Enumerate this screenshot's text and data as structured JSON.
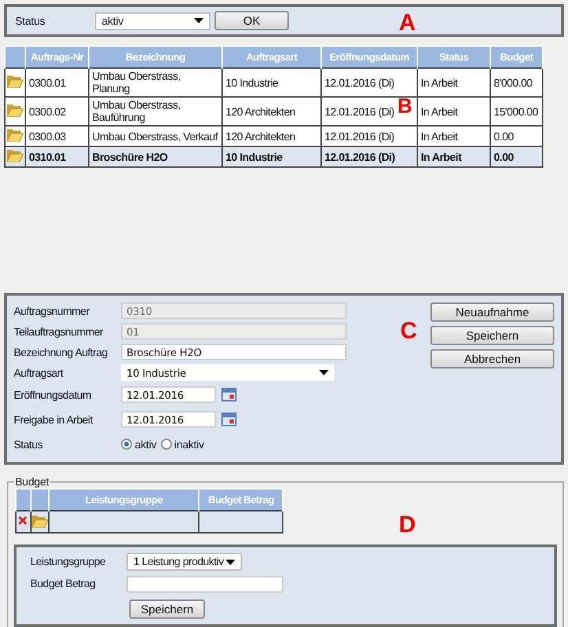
{
  "filter": {
    "label": "Status",
    "value": "aktiv",
    "button": "OK",
    "marker": "A"
  },
  "orders": {
    "marker": "B",
    "columns": [
      "Auftrags-Nr",
      "Bezeichnung",
      "Auftragsart",
      "Eröffnungsdatum",
      "Status",
      "Budget"
    ],
    "rows": [
      {
        "selected": false,
        "cells": [
          "0300.01",
          "Umbau Oberstrass, Planung",
          "10 Industrie",
          "12.01.2016 (Di)",
          "In Arbeit",
          "8'000.00"
        ]
      },
      {
        "selected": false,
        "cells": [
          "0300.02",
          "Umbau Oberstrass, Bauführung",
          "120 Architekten",
          "12.01.2016 (Di)",
          "In Arbeit",
          "15'000.00"
        ]
      },
      {
        "selected": false,
        "cells": [
          "0300.03",
          "Umbau Oberstrass, Verkauf",
          "120 Architekten",
          "12.01.2016 (Di)",
          "In Arbeit",
          "0.00"
        ]
      },
      {
        "selected": true,
        "cells": [
          "0310.01",
          "Broschüre H2O",
          "10 Industrie",
          "12.01.2016 (Di)",
          "In Arbeit",
          "0.00"
        ]
      }
    ]
  },
  "order_form": {
    "marker": "C",
    "fields": [
      {
        "kind": "readonly",
        "label": "Auftragsnummer",
        "value": "0310"
      },
      {
        "kind": "readonly",
        "label": "Teilauftragsnummer",
        "value": "01"
      },
      {
        "kind": "text",
        "label": "Bezeichnung Auftrag",
        "value": "Broschüre H2O"
      },
      {
        "kind": "select",
        "label": "Auftragsart",
        "value": "10 Industrie"
      },
      {
        "kind": "date",
        "label": "Eröffnungsdatum",
        "value": "12.01.2016"
      },
      {
        "kind": "date",
        "label": "Freigabe in Arbeit",
        "value": "12.01.2016"
      },
      {
        "kind": "radio",
        "label": "Status",
        "options": [
          {
            "label": "aktiv",
            "selected": true
          },
          {
            "label": "inaktiv",
            "selected": false
          }
        ]
      }
    ],
    "buttons": [
      "Neuaufnahme",
      "Speichern",
      "Abbrechen"
    ]
  },
  "budget": {
    "legend": "Budget",
    "marker": "D",
    "columns": [
      "Leistungsgruppe",
      "Budget Betrag"
    ],
    "form": {
      "group_label": "Leistungsgruppe",
      "group_value": "1 Leistung produktiv",
      "amount_label": "Budget Betrag",
      "button": "Speichern"
    }
  }
}
